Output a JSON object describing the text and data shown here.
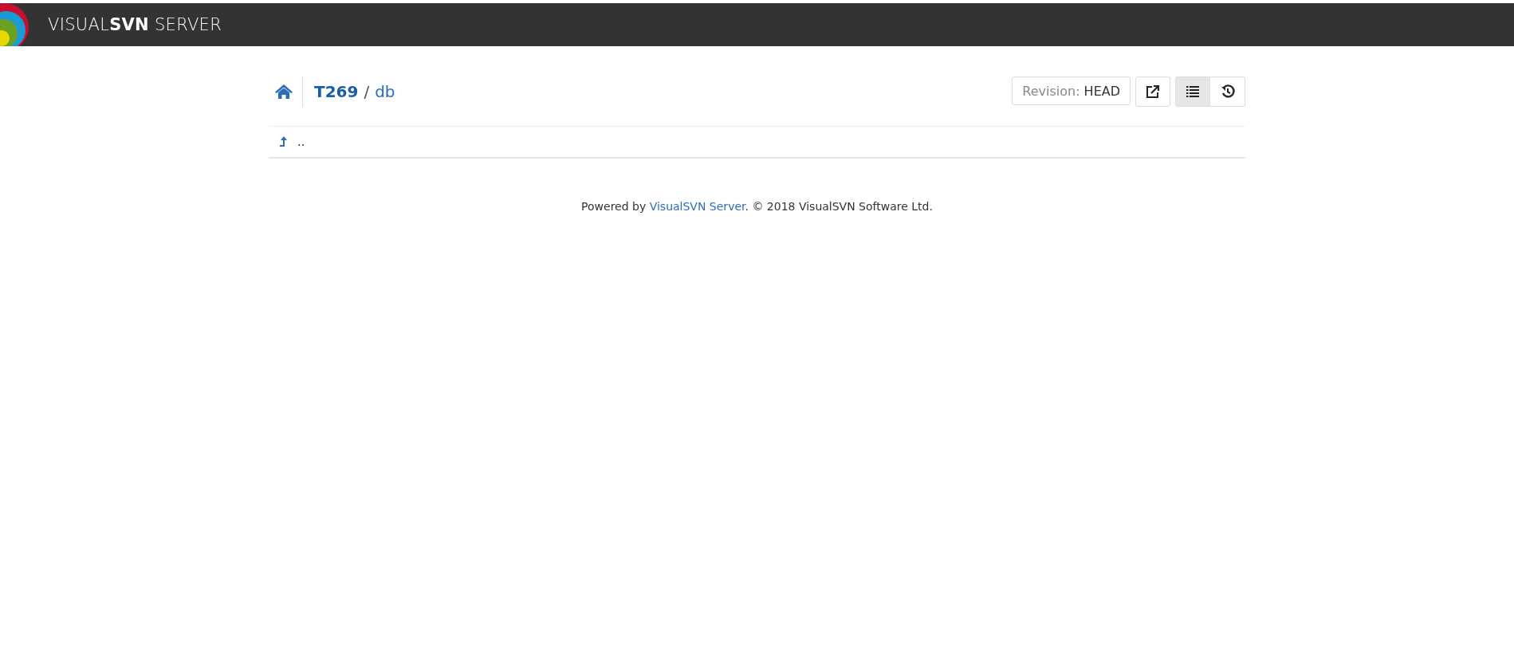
{
  "header": {
    "logo_text": "VISUAL**SVN** SERVER"
  },
  "breadcrumb": {
    "repository": "T269",
    "separator": "/",
    "path": "db"
  },
  "toolbar": {
    "revision_label": "Revision:",
    "revision_value": "HEAD",
    "view_buttons": [
      {
        "kind": "list",
        "selected": true
      },
      {
        "kind": "history",
        "selected": false
      }
    ]
  },
  "entries": [
    {
      "kind": "parent",
      "name": ".."
    }
  ],
  "footer": {
    "prefix": "Powered by ",
    "link": "VisualSVN Server",
    "suffix": ". © 2018 VisualSVN Software Ltd."
  }
}
